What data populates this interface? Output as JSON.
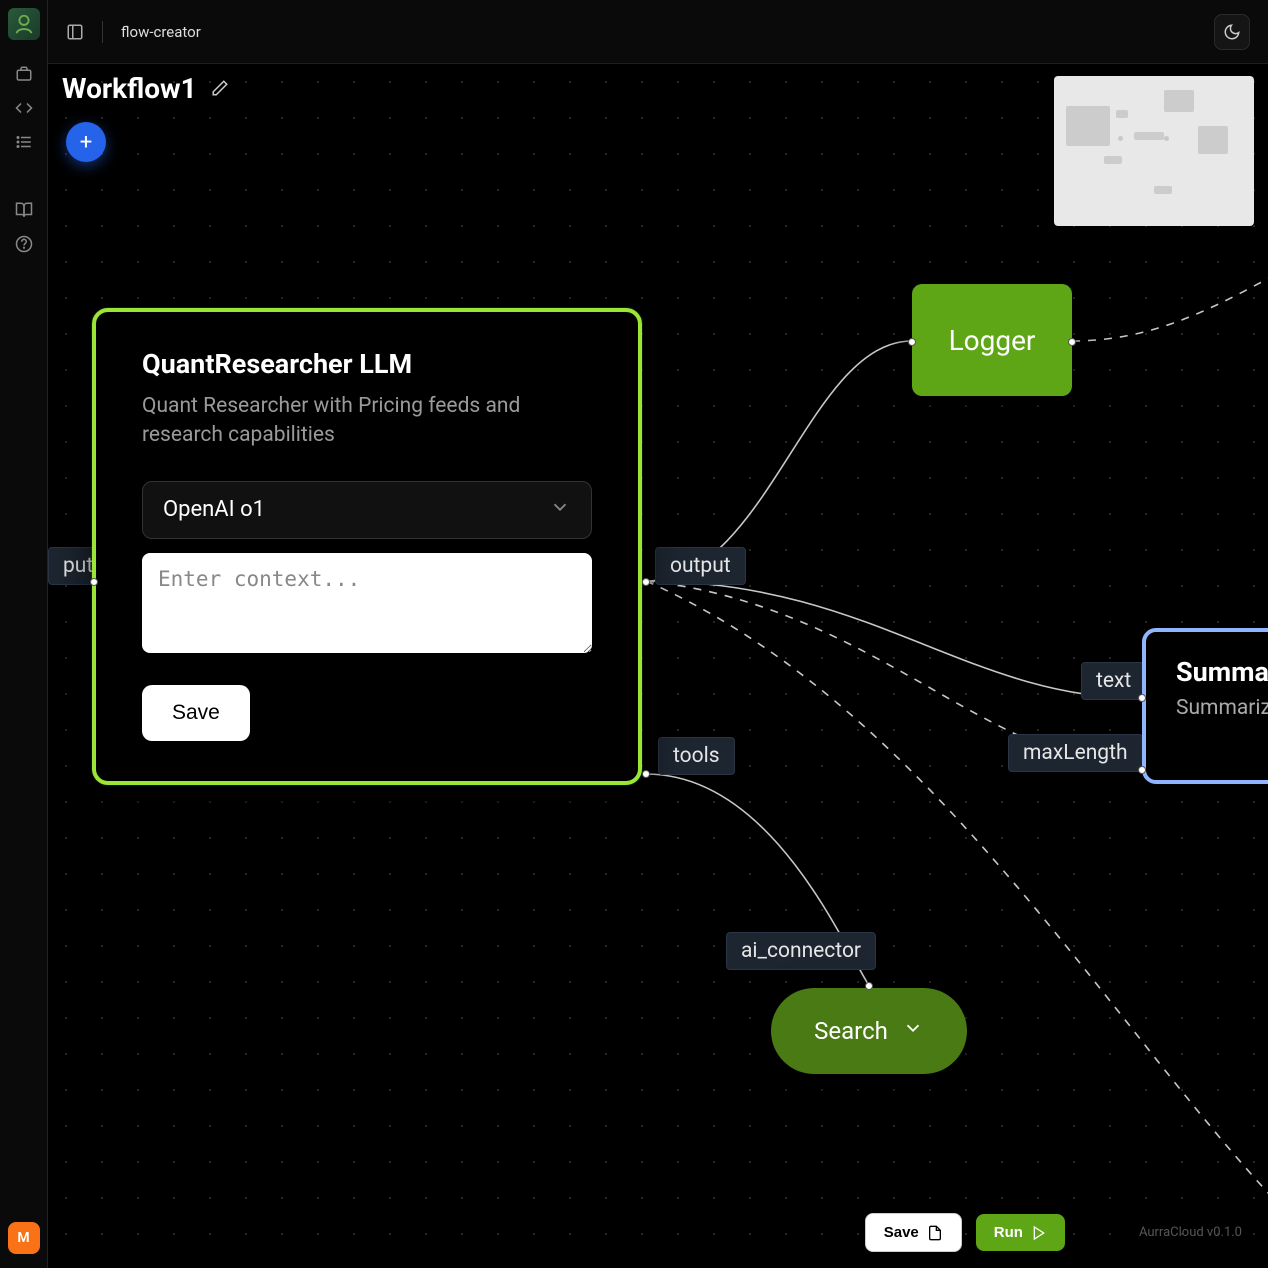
{
  "app": {
    "breadcrumb": "flow-creator",
    "version": "AurraCloud v0.1.0",
    "avatar_letter": "M"
  },
  "workflow": {
    "title": "Workflow1",
    "add_label": "+"
  },
  "buttons": {
    "save_footer": "Save",
    "run_footer": "Run"
  },
  "ports": {
    "input": "put",
    "output": "output",
    "tools": "tools",
    "ai_connector": "ai_connector",
    "text": "text",
    "maxLength": "maxLength"
  },
  "nodes": {
    "main": {
      "title": "QuantResearcher LLM",
      "description": "Quant Researcher with Pricing feeds and research capabilities",
      "model": "OpenAI o1",
      "context_placeholder": "Enter context...",
      "save_label": "Save"
    },
    "logger": {
      "title": "Logger"
    },
    "summarize": {
      "title": "Summari",
      "description": "Summarize"
    },
    "search": {
      "title": "Search"
    }
  },
  "colors": {
    "accent_green": "#9ae637",
    "node_green": "#5fa617",
    "accent_blue": "#8fb5ff",
    "add_blue": "#2563eb",
    "avatar_orange": "#f97316"
  }
}
